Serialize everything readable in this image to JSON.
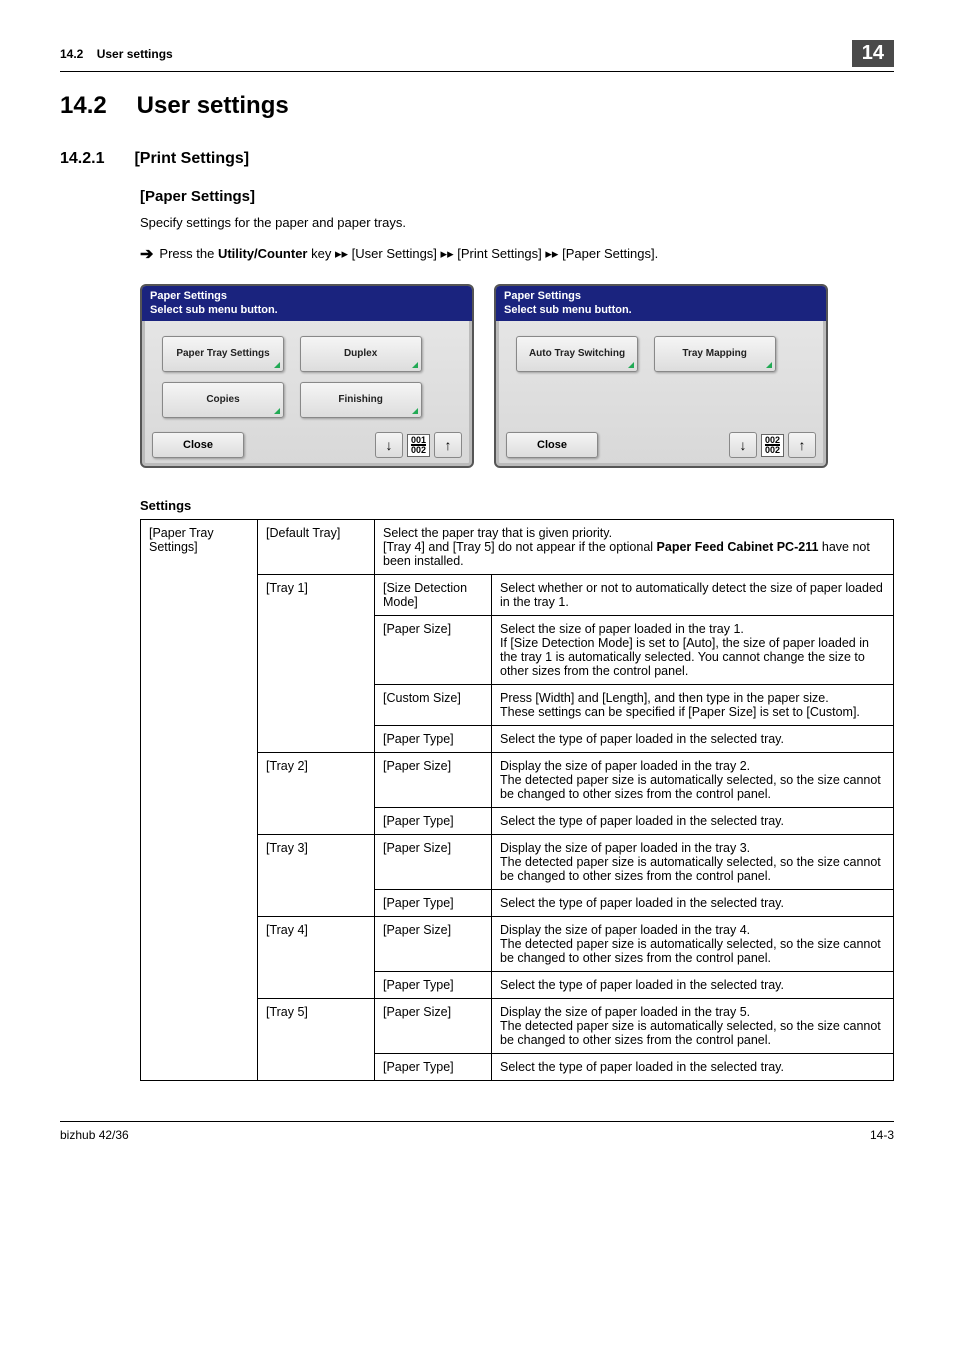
{
  "header": {
    "section": "14.2",
    "title": "User settings",
    "chapter": "14"
  },
  "h1": {
    "num": "14.2",
    "text": "User settings"
  },
  "h2": {
    "num": "14.2.1",
    "text": "[Print Settings]"
  },
  "h3": {
    "text": "[Paper Settings]"
  },
  "intro": "Specify settings for the paper and paper trays.",
  "nav": {
    "prefix": "Press the ",
    "key": "Utility/Counter",
    "after_key": " key ",
    "sep": "▸▸",
    "p1": "[User Settings]",
    "p2": "[Print Settings]",
    "p3": "[Paper Settings].",
    "arrow": "➔"
  },
  "panel1": {
    "title1": "Paper Settings",
    "title2": "Select sub menu button.",
    "b1": "Paper Tray Settings",
    "b2": "Duplex",
    "b3": "Copies",
    "b4": "Finishing",
    "close": "Close",
    "page_top": "001",
    "page_bot": "002"
  },
  "panel2": {
    "title1": "Paper Settings",
    "title2": "Select sub menu button.",
    "b1": "Auto Tray Switching",
    "b2": "Tray Mapping",
    "close": "Close",
    "page_top": "002",
    "page_bot": "002"
  },
  "settings_label": "Settings",
  "table": {
    "r1c1": "[Paper Tray Settings]",
    "r1c2": "[Default Tray]",
    "r1c3a": "Select the paper tray that is given priority.",
    "r1c3b": "[Tray 4] and [Tray 5] do not appear if the optional ",
    "r1c3bold": "Paper Feed Cabinet PC-211",
    "r1c3c": " have not been installed.",
    "tray1": "[Tray 1]",
    "t1a": "[Size Detection Mode]",
    "t1a_d": "Select whether or not to automatically detect the size of paper loaded in the tray 1.",
    "t1b": "[Paper Size]",
    "t1b_d": "Select the size of paper loaded in the tray 1.\nIf [Size Detection Mode] is set to [Auto], the size of paper loaded in the tray 1 is automatically selected. You cannot change the size to other sizes from the control panel.",
    "t1c": "[Custom Size]",
    "t1c_d": "Press [Width] and [Length], and then type in the paper size.\nThese settings can be specified if [Paper Size] is set to [Custom].",
    "t1d": "[Paper Type]",
    "t1d_d": "Select the type of paper loaded in the selected tray.",
    "tray2": "[Tray 2]",
    "t2a": "[Paper Size]",
    "t2a_d": "Display the size of paper loaded in the tray 2.\nThe detected paper size is automatically selected, so the size cannot be changed to other sizes from the control panel.",
    "t2b": "[Paper Type]",
    "t2b_d": "Select the type of paper loaded in the selected tray.",
    "tray3": "[Tray 3]",
    "t3a": "[Paper Size]",
    "t3a_d": "Display the size of paper loaded in the tray 3.\nThe detected paper size is automatically selected, so the size cannot be changed to other sizes from the control panel.",
    "t3b": "[Paper Type]",
    "t3b_d": "Select the type of paper loaded in the selected tray.",
    "tray4": "[Tray 4]",
    "t4a": "[Paper Size]",
    "t4a_d": "Display the size of paper loaded in the tray 4.\nThe detected paper size is automatically selected, so the size cannot be changed to other sizes from the control panel.",
    "t4b": "[Paper Type]",
    "t4b_d": "Select the type of paper loaded in the selected tray.",
    "tray5": "[Tray 5]",
    "t5a": "[Paper Size]",
    "t5a_d": "Display the size of paper loaded in the tray 5.\nThe detected paper size is automatically selected, so the size cannot be changed to other sizes from the control panel.",
    "t5b": "[Paper Type]",
    "t5b_d": "Select the type of paper loaded in the selected tray."
  },
  "footer": {
    "left": "bizhub 42/36",
    "right": "14-3"
  }
}
